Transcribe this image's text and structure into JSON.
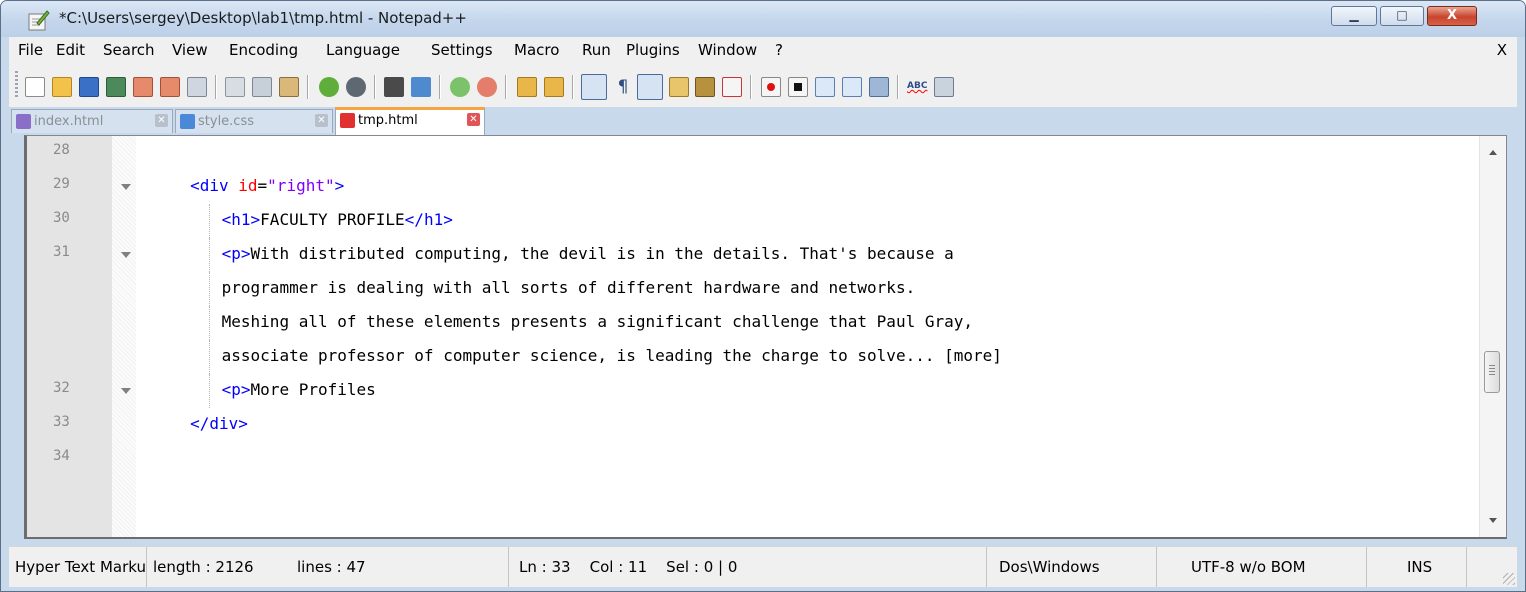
{
  "window": {
    "title": "*C:\\Users\\sergey\\Desktop\\lab1\\tmp.html - Notepad++",
    "controls": {
      "minimize": "▭",
      "maximize": "□",
      "close": "X"
    }
  },
  "menu": {
    "items": [
      "File",
      "Edit",
      "Search",
      "View",
      "Encoding",
      "Language",
      "Settings",
      "Macro",
      "Run",
      "Plugins",
      "Window",
      "?"
    ],
    "close_label": "X"
  },
  "toolbar": {
    "buttons": [
      "new-file-icon",
      "open-file-icon",
      "save-icon",
      "save-all-icon",
      "close-icon",
      "close-all-icon",
      "print-icon",
      "cut-icon",
      "copy-icon",
      "paste-icon",
      "undo-icon",
      "redo-icon",
      "find-icon",
      "replace-icon",
      "zoom-in-icon",
      "zoom-out-icon",
      "sync-vertical-icon",
      "sync-horizontal-icon",
      "word-wrap-icon",
      "show-all-chars-icon",
      "indent-guide-icon",
      "user-defined-language-icon",
      "document-map-icon",
      "function-list-icon",
      "record-macro-icon",
      "stop-record-icon",
      "play-macro-icon",
      "run-macro-multiple-icon",
      "save-macro-icon",
      "spell-check-icon",
      "spell-options-icon"
    ],
    "pilcrow": "¶",
    "spell_label": "ABC"
  },
  "tabs": [
    {
      "label": "index.html",
      "active": false,
      "color": "#8a6fc8"
    },
    {
      "label": "style.css",
      "active": false,
      "color": "#4a88d8"
    },
    {
      "label": "tmp.html",
      "active": true,
      "color": "#e03030"
    }
  ],
  "editor": {
    "lines": [
      {
        "num": "28",
        "fold": false,
        "indent": 0,
        "segments": []
      },
      {
        "num": "29",
        "fold": true,
        "indent": 2,
        "segments": [
          {
            "t": "tag",
            "v": "<div "
          },
          {
            "t": "attr",
            "v": "id"
          },
          {
            "t": "plain",
            "v": "="
          },
          {
            "t": "val",
            "v": "\"right\""
          },
          {
            "t": "tag",
            "v": ">"
          }
        ]
      },
      {
        "num": "30",
        "fold": false,
        "indent": 3,
        "segments": [
          {
            "t": "tag",
            "v": "<h1>"
          },
          {
            "t": "plain",
            "v": "FACULTY PROFILE"
          },
          {
            "t": "tag",
            "v": "</h1>"
          }
        ]
      },
      {
        "num": "31",
        "fold": true,
        "indent": 3,
        "segments": [
          {
            "t": "tag",
            "v": "<p>"
          },
          {
            "t": "plain",
            "v": "With distributed computing, the devil is in the details. That's because a"
          }
        ]
      },
      {
        "num": "",
        "fold": false,
        "indent": 3,
        "segments": [
          {
            "t": "plain",
            "v": "programmer is dealing with all sorts of different hardware and networks."
          }
        ]
      },
      {
        "num": "",
        "fold": false,
        "indent": 3,
        "segments": [
          {
            "t": "plain",
            "v": "Meshing all of these elements presents a significant challenge that Paul Gray,"
          }
        ]
      },
      {
        "num": "",
        "fold": false,
        "indent": 3,
        "segments": [
          {
            "t": "plain",
            "v": "associate professor of computer science, is leading the charge to solve... [more]"
          }
        ]
      },
      {
        "num": "32",
        "fold": true,
        "indent": 3,
        "segments": [
          {
            "t": "tag",
            "v": "<p>"
          },
          {
            "t": "plain",
            "v": "More Profiles"
          }
        ]
      },
      {
        "num": "33",
        "fold": false,
        "indent": 2,
        "segments": [
          {
            "t": "tag",
            "v": "</div>"
          }
        ]
      },
      {
        "num": "34",
        "fold": false,
        "indent": 0,
        "segments": []
      }
    ]
  },
  "statusbar": {
    "language": "Hyper Text Markup Language file",
    "length": "length : 2126",
    "lines": "lines : 47",
    "position": "Ln : 33    Col : 11    Sel : 0 | 0",
    "eol": "Dos\\Windows",
    "encoding": "UTF-8 w/o BOM",
    "mode": "INS"
  }
}
